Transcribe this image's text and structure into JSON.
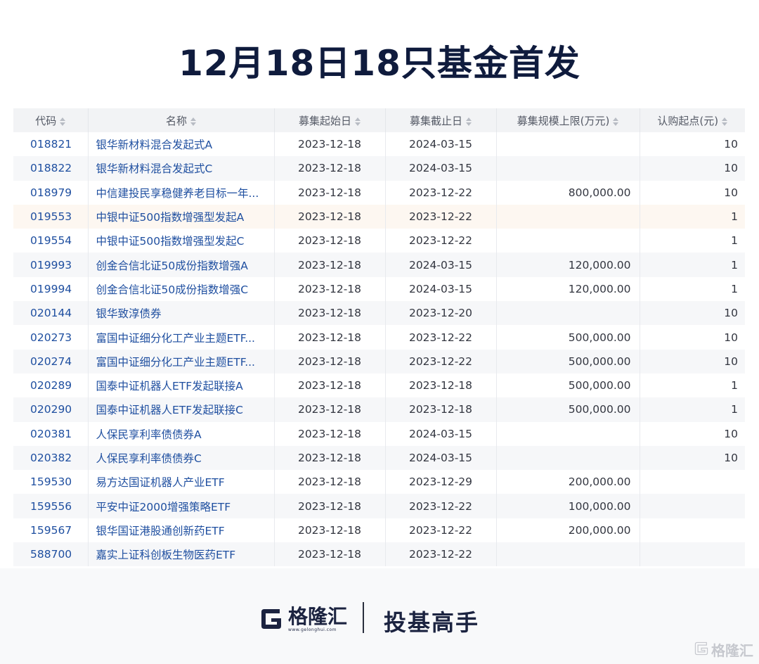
{
  "title": "12月18日18只基金首发",
  "table": {
    "columns": [
      "代码",
      "名称",
      "募集起始日",
      "募集截止日",
      "募集规模上限(万元)",
      "认购起点(元)"
    ],
    "rows": [
      {
        "code": "018821",
        "name": "银华新材料混合发起式A",
        "start": "2023-12-18",
        "end": "2024-03-15",
        "size": "",
        "min": "10"
      },
      {
        "code": "018822",
        "name": "银华新材料混合发起式C",
        "start": "2023-12-18",
        "end": "2024-03-15",
        "size": "",
        "min": "10"
      },
      {
        "code": "018979",
        "name": "中信建投民享稳健养老目标一年...",
        "start": "2023-12-18",
        "end": "2023-12-22",
        "size": "800,000.00",
        "min": "10"
      },
      {
        "code": "019553",
        "name": "中银中证500指数增强型发起A",
        "start": "2023-12-18",
        "end": "2023-12-22",
        "size": "",
        "min": "1"
      },
      {
        "code": "019554",
        "name": "中银中证500指数增强型发起C",
        "start": "2023-12-18",
        "end": "2023-12-22",
        "size": "",
        "min": "1"
      },
      {
        "code": "019993",
        "name": "创金合信北证50成份指数增强A",
        "start": "2023-12-18",
        "end": "2024-03-15",
        "size": "120,000.00",
        "min": "1"
      },
      {
        "code": "019994",
        "name": "创金合信北证50成份指数增强C",
        "start": "2023-12-18",
        "end": "2024-03-15",
        "size": "120,000.00",
        "min": "1"
      },
      {
        "code": "020144",
        "name": "银华致淳债券",
        "start": "2023-12-18",
        "end": "2023-12-20",
        "size": "",
        "min": "10"
      },
      {
        "code": "020273",
        "name": "富国中证细分化工产业主题ETF...",
        "start": "2023-12-18",
        "end": "2023-12-22",
        "size": "500,000.00",
        "min": "10"
      },
      {
        "code": "020274",
        "name": "富国中证细分化工产业主题ETF...",
        "start": "2023-12-18",
        "end": "2023-12-22",
        "size": "500,000.00",
        "min": "10"
      },
      {
        "code": "020289",
        "name": "国泰中证机器人ETF发起联接A",
        "start": "2023-12-18",
        "end": "2023-12-18",
        "size": "500,000.00",
        "min": "1"
      },
      {
        "code": "020290",
        "name": "国泰中证机器人ETF发起联接C",
        "start": "2023-12-18",
        "end": "2023-12-18",
        "size": "500,000.00",
        "min": "1"
      },
      {
        "code": "020381",
        "name": "人保民享利率债债券A",
        "start": "2023-12-18",
        "end": "2024-03-15",
        "size": "",
        "min": "10"
      },
      {
        "code": "020382",
        "name": "人保民享利率债债券C",
        "start": "2023-12-18",
        "end": "2024-03-15",
        "size": "",
        "min": "10"
      },
      {
        "code": "159530",
        "name": "易方达国证机器人产业ETF",
        "start": "2023-12-18",
        "end": "2023-12-29",
        "size": "200,000.00",
        "min": ""
      },
      {
        "code": "159556",
        "name": "平安中证2000增强策略ETF",
        "start": "2023-12-18",
        "end": "2023-12-22",
        "size": "100,000.00",
        "min": ""
      },
      {
        "code": "159567",
        "name": "银华国证港股通创新药ETF",
        "start": "2023-12-18",
        "end": "2023-12-22",
        "size": "200,000.00",
        "min": ""
      },
      {
        "code": "588700",
        "name": "嘉实上证科创板生物医药ETF",
        "start": "2023-12-18",
        "end": "2023-12-22",
        "size": "",
        "min": ""
      }
    ],
    "highlighted_row": 3
  },
  "footer": {
    "logo_name": "格隆汇",
    "logo_url": "www.gelonghui.com",
    "slogan": "投基高手",
    "watermark": "格隆汇"
  },
  "colors": {
    "title": "#0f1b3d",
    "link": "#1f4fa0",
    "header_bg": "#f2f3f5",
    "highlight": "#fdf7f1"
  },
  "icons": {
    "sort": "sort-icon",
    "brand": "gelonghui-g-icon"
  }
}
